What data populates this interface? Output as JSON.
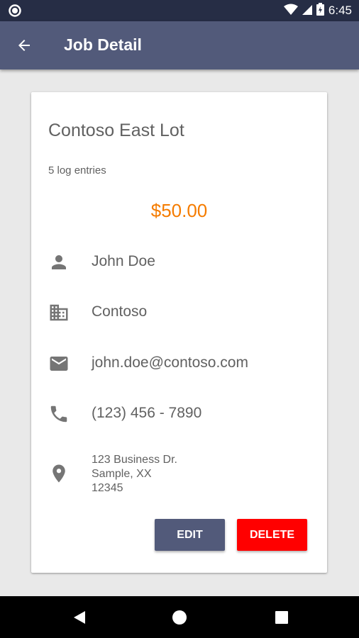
{
  "status_bar": {
    "time": "6:45"
  },
  "toolbar": {
    "title": "Job Detail",
    "back_icon": "arrow-back-icon"
  },
  "job": {
    "title": "Contoso East Lot",
    "log_entries": "5 log entries",
    "amount": "$50.00",
    "contact_name": "John Doe",
    "company": "Contoso",
    "email": "john.doe@contoso.com",
    "phone": "(123) 456 - 7890",
    "address_line1": "123 Business Dr.",
    "address_line2": "Sample, XX",
    "address_line3": "12345"
  },
  "buttons": {
    "edit_label": "EDIT",
    "delete_label": "DELETE"
  },
  "colors": {
    "status_bar": "#262d45",
    "toolbar": "#525a7a",
    "amount": "#f57c00",
    "delete": "#ff0000"
  },
  "icons": {
    "contact": "person-icon",
    "company": "business-icon",
    "email": "email-icon",
    "phone": "phone-icon",
    "address": "location-icon"
  }
}
